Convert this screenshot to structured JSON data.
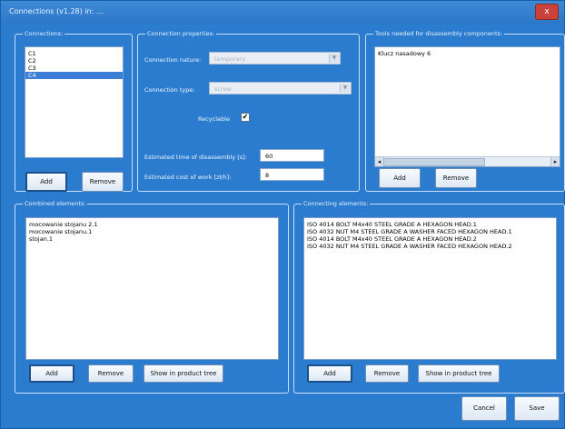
{
  "window": {
    "title": "Connections (v1.28) in: ...",
    "close_label": "x"
  },
  "connections": {
    "legend": "Connections:",
    "items": [
      "C1",
      "C2",
      "C3",
      "C4"
    ],
    "selected": "C4",
    "add_label": "Add",
    "remove_label": "Remove"
  },
  "properties": {
    "legend": "Connection properties:",
    "nature_label": "Connection nature:",
    "nature_value": "temporary",
    "type_label": "Connection type:",
    "type_value": "screw",
    "recyclable_label": "Recyclable",
    "recyclable_checked": true,
    "check_mark": "✔",
    "time_label": "Estimated time of disassembly [s]:",
    "time_value": "60",
    "cost_label": "Estimated cost of work [zł/h]:",
    "cost_value": "8"
  },
  "tools": {
    "legend": "Tools needed for disassembly components:",
    "items": [
      "Klucz nasadowy 6"
    ],
    "add_label": "Add",
    "remove_label": "Remove"
  },
  "combined": {
    "legend": "Combined elements:",
    "items": [
      "mocowanie stojanu 2.1",
      "mocowanie stojanu.1",
      "stojan.1"
    ],
    "add_label": "Add",
    "remove_label": "Remove",
    "show_label": "Show in product tree"
  },
  "connecting": {
    "legend": "Connecting elements:",
    "items": [
      "ISO 4014 BOLT M4x40 STEEL GRADE A HEXAGON HEAD.1",
      "ISO 4032 NUT M4 STEEL GRADE A WASHER FACED HEXAGON HEAD.1",
      "ISO 4014 BOLT M4x40 STEEL GRADE A HEXAGON HEAD.2",
      "ISO 4032 NUT M4 STEEL GRADE A WASHER FACED HEXAGON HEAD.2"
    ],
    "add_label": "Add",
    "remove_label": "Remove",
    "show_label": "Show in product tree"
  },
  "footer": {
    "cancel_label": "Cancel",
    "save_label": "Save"
  },
  "icons": {
    "close": "close-icon",
    "dropdown": "chevron-down-icon",
    "scroll_left": "arrow-left-icon",
    "scroll_right": "arrow-right-icon"
  },
  "colors": {
    "window_bg": "#2b7ccf",
    "selection": "#3d7fd6",
    "close_button": "#c9433b"
  }
}
